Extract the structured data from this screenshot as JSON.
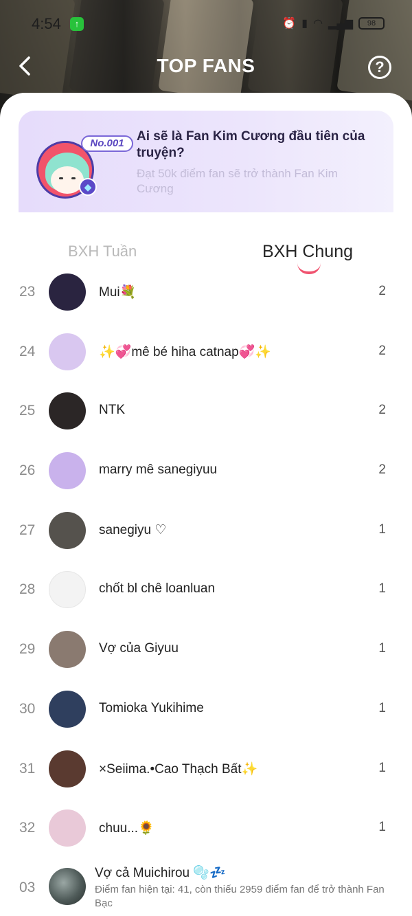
{
  "status_bar": {
    "time": "4:54",
    "battery": "98"
  },
  "header": {
    "title": "TOP FANS",
    "back_icon": "chevron-left-icon",
    "help_icon": "question-circle-icon"
  },
  "banner": {
    "badge": "No.001",
    "title": "Ai sẽ là Fan Kim Cương đầu tiên của truyện?",
    "subtitle": "Đạt 50k điểm fan sẽ trở thành Fan Kim Cương"
  },
  "tabs": [
    {
      "label": "BXH Tuần",
      "active": false
    },
    {
      "label": "BXH Chung",
      "active": true
    }
  ],
  "colors": {
    "accent": "#f0536f",
    "banner_bg": "#e6dcfb"
  },
  "ranking": [
    {
      "rank": "23",
      "name": "Mui💐",
      "score": "2",
      "avatar_color": "#2a2440"
    },
    {
      "rank": "24",
      "name": "✨💞mê bé hiha catnap💞✨",
      "score": "2",
      "avatar_color": "#d9c7f0"
    },
    {
      "rank": "25",
      "name": "NTK",
      "score": "2",
      "avatar_color": "#2b2626"
    },
    {
      "rank": "26",
      "name": "marry mê sanegiyuu",
      "score": "2",
      "avatar_color": "#c9b2ec"
    },
    {
      "rank": "27",
      "name": "sanegiyu ♡",
      "score": "1",
      "avatar_color": "#55524d"
    },
    {
      "rank": "28",
      "name": "chốt bl chê loanluan",
      "score": "1",
      "avatar_color": "#f3f3f3"
    },
    {
      "rank": "29",
      "name": "Vợ của Giyuu",
      "score": "1",
      "avatar_color": "#8a7a70"
    },
    {
      "rank": "30",
      "name": "Tomioka Yukihime",
      "score": "1",
      "avatar_color": "#2f3f5e"
    },
    {
      "rank": "31",
      "name": "×Seiima.•Cao Thạch Bất✨",
      "score": "1",
      "avatar_color": "#5a3a30"
    },
    {
      "rank": "32",
      "name": "chuu...🌻",
      "score": "1",
      "avatar_color": "#e9c9d8"
    }
  ],
  "current_user": {
    "rank": "03",
    "name": "Vợ cả Muichirou 🫧💤",
    "progress_text": "Điểm fan hiện tại: 41, còn thiếu 2959 điểm fan để trở thành Fan Bạc"
  }
}
